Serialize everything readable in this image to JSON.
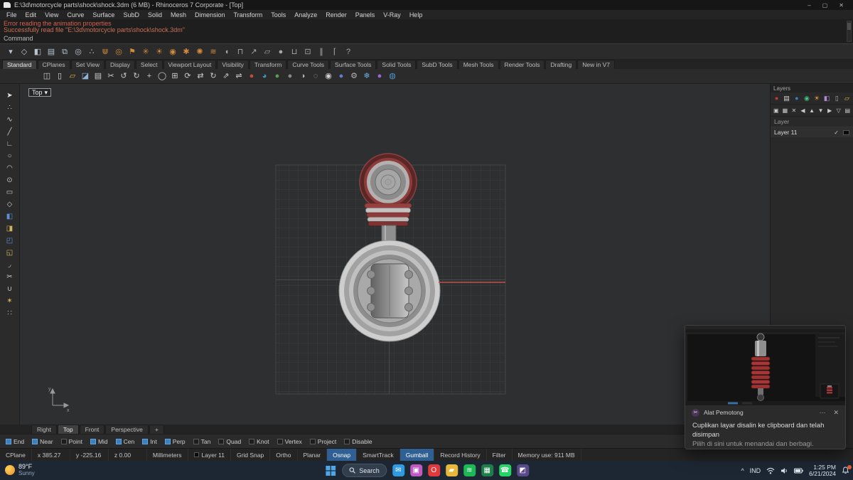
{
  "colors": {
    "accent_orange": "#d08b3c",
    "osnap_blue": "#3a7fbf",
    "error_red": "#d65f4f",
    "red_axis_line": "#c4504e",
    "viewport_bg": "#2e2f31"
  },
  "title_bar": {
    "title": "E:\\3d\\motorcycle parts\\shock\\shock.3dm (6 MB) - Rhinoceros 7 Corporate - [Top]",
    "minimize": "–",
    "maximize": "▢",
    "close": "✕"
  },
  "menu_bar": {
    "items": [
      {
        "label": "File"
      },
      {
        "label": "Edit"
      },
      {
        "label": "View"
      },
      {
        "label": "Curve"
      },
      {
        "label": "Surface"
      },
      {
        "label": "SubD"
      },
      {
        "label": "Solid"
      },
      {
        "label": "Mesh"
      },
      {
        "label": "Dimension"
      },
      {
        "label": "Transform"
      },
      {
        "label": "Tools"
      },
      {
        "label": "Analyze"
      },
      {
        "label": "Render"
      },
      {
        "label": "Panels"
      },
      {
        "label": "V-Ray"
      },
      {
        "label": "Help"
      }
    ]
  },
  "command_area": {
    "lines": [
      {
        "text": "Error reading the animation properties",
        "color": "#d65f4f"
      },
      {
        "text": "Successfully read file \"E:\\3d\\motorcycle parts\\shock\\shock.3dm\"",
        "color": "#c97055"
      }
    ],
    "prompt": "Command"
  },
  "toolbar_tabs": {
    "items": [
      {
        "label": "Standard",
        "state": "active"
      },
      {
        "label": "CPlanes"
      },
      {
        "label": "Set View"
      },
      {
        "label": "Display"
      },
      {
        "label": "Select"
      },
      {
        "label": "Viewport Layout"
      },
      {
        "label": "Visibility"
      },
      {
        "label": "Transform"
      },
      {
        "label": "Curve Tools"
      },
      {
        "label": "Surface Tools"
      },
      {
        "label": "Solid Tools"
      },
      {
        "label": "SubD Tools"
      },
      {
        "label": "Mesh Tools"
      },
      {
        "label": "Render Tools"
      },
      {
        "label": "Drafting"
      },
      {
        "label": "New in V7"
      }
    ]
  },
  "toolbar_main": {
    "icons": [
      {
        "name": "popup-menu-icon",
        "glyph": "▾",
        "color": "#b9c4cf"
      },
      {
        "name": "object-snap-icon",
        "glyph": "◇",
        "color": "#b9c4cf"
      },
      {
        "name": "display-mode-icon",
        "glyph": "◧",
        "color": "#b9c4cf"
      },
      {
        "name": "layer-state-icon",
        "glyph": "▤",
        "color": "#b9c4cf"
      },
      {
        "name": "group-objects-icon",
        "glyph": "⧉",
        "color": "#b9c4cf"
      },
      {
        "name": "visibility-icon",
        "glyph": "◎",
        "color": "#b9c4cf"
      },
      {
        "name": "select-points-icon",
        "glyph": "∴",
        "color": "#b9c4cf"
      },
      {
        "name": "mesh-cup-icon",
        "glyph": "⋓",
        "color": "#d08b3c"
      },
      {
        "name": "torus-icon",
        "glyph": "◎",
        "color": "#d08b3c"
      },
      {
        "name": "cone-flag-icon",
        "glyph": "⚑",
        "color": "#d08b3c"
      },
      {
        "name": "star-points-icon",
        "glyph": "✳",
        "color": "#d08b3c"
      },
      {
        "name": "sun-icon",
        "glyph": "☀",
        "color": "#d08b3c"
      },
      {
        "name": "donut-icon",
        "glyph": "◉",
        "color": "#d08b3c"
      },
      {
        "name": "gear-icon",
        "glyph": "✱",
        "color": "#d08b3c"
      },
      {
        "name": "spark-icon",
        "glyph": "✺",
        "color": "#d08b3c"
      },
      {
        "name": "hatch-lines-icon",
        "glyph": "≋",
        "color": "#d08b3c"
      },
      {
        "name": "lamp-icon",
        "glyph": "◖",
        "color": "#a8a8a8"
      },
      {
        "name": "magnet-icon",
        "glyph": "⊓",
        "color": "#a8a8a8"
      },
      {
        "name": "arrow-tool-icon",
        "glyph": "↗",
        "color": "#a8a8a8"
      },
      {
        "name": "plane-icon",
        "glyph": "▱",
        "color": "#a8a8a8"
      },
      {
        "name": "sphere-tool-icon",
        "glyph": "●",
        "color": "#a8a8a8"
      },
      {
        "name": "cylinder-tool-icon",
        "glyph": "⊔",
        "color": "#a8a8a8"
      },
      {
        "name": "box-tool-icon",
        "glyph": "⊡",
        "color": "#a8a8a8"
      },
      {
        "name": "pipe-tool-icon",
        "glyph": "∥",
        "color": "#a8a8a8"
      },
      {
        "name": "bracket-tool-icon",
        "glyph": "⌈",
        "color": "#a8a8a8"
      },
      {
        "name": "help-icon",
        "glyph": "?",
        "color": "#a8a8a8"
      }
    ]
  },
  "toolbar_second": {
    "icons": [
      {
        "name": "paste-icon",
        "glyph": "◫",
        "color": "#c9c9c9"
      },
      {
        "name": "new-file-icon",
        "glyph": "▯",
        "color": "#dcdcdc"
      },
      {
        "name": "open-folder-icon",
        "glyph": "▱",
        "color": "#d9b23f"
      },
      {
        "name": "save-icon",
        "glyph": "◪",
        "color": "#8fb3d9"
      },
      {
        "name": "print-icon",
        "glyph": "▤",
        "color": "#c9c9c9"
      },
      {
        "name": "cut-icon",
        "glyph": "✂",
        "color": "#c9c9c9"
      },
      {
        "name": "undo-icon",
        "glyph": "↺",
        "color": "#c9c9c9"
      },
      {
        "name": "redo-icon",
        "glyph": "↻",
        "color": "#c9c9c9"
      },
      {
        "name": "pan-icon",
        "glyph": "+",
        "color": "#c9c9c9"
      },
      {
        "name": "zoom-icon",
        "glyph": "◯",
        "color": "#c9c9c9"
      },
      {
        "name": "zoom-extents-icon",
        "glyph": "⊞",
        "color": "#c9c9c9"
      },
      {
        "name": "rotate-view-icon",
        "glyph": "⟳",
        "color": "#c9c9c9"
      },
      {
        "name": "move-icon",
        "glyph": "⇄",
        "color": "#c9c9c9"
      },
      {
        "name": "rotate-icon",
        "glyph": "↻",
        "color": "#c9c9c9"
      },
      {
        "name": "scale-icon",
        "glyph": "⇗",
        "color": "#c9c9c9"
      },
      {
        "name": "mirror-icon",
        "glyph": "⇌",
        "color": "#c9c9c9"
      },
      {
        "name": "red-sphere-icon",
        "glyph": "●",
        "color": "#c14a3a"
      },
      {
        "name": "rgb-sphere-icon",
        "glyph": "◕",
        "color": "#3a9ac0"
      },
      {
        "name": "green-sphere-icon",
        "glyph": "●",
        "color": "#55a055"
      },
      {
        "name": "gray-sphere-icon",
        "glyph": "●",
        "color": "#8a8a8a"
      },
      {
        "name": "shaded-sphere-icon",
        "glyph": "◑",
        "color": "#b5b5b5"
      },
      {
        "name": "wire-sphere-icon",
        "glyph": "◌",
        "color": "#b5b5b5"
      },
      {
        "name": "render-icon",
        "glyph": "◉",
        "color": "#d0d0d0"
      },
      {
        "name": "material-sphere-icon",
        "glyph": "●",
        "color": "#5a7fd4"
      },
      {
        "name": "options-gear-icon",
        "glyph": "⚙",
        "color": "#b5b5b5"
      },
      {
        "name": "snowflake-icon",
        "glyph": "❄",
        "color": "#6ab0e8"
      },
      {
        "name": "purple-sphere-icon",
        "glyph": "●",
        "color": "#9a6ad4"
      },
      {
        "name": "earth-icon",
        "glyph": "◍",
        "color": "#4a9ad4"
      }
    ]
  },
  "sidebar": {
    "icons": [
      {
        "name": "select-arrow-icon",
        "glyph": "➤",
        "color": "#e2e2e2"
      },
      {
        "name": "points-icon",
        "glyph": "∴",
        "color": "#c9c9c9"
      },
      {
        "name": "curve-icon",
        "glyph": "∿",
        "color": "#c9c9c9"
      },
      {
        "name": "line-icon",
        "glyph": "╱",
        "color": "#c9c9c9"
      },
      {
        "name": "polyline-icon",
        "glyph": "∟",
        "color": "#c9c9c9"
      },
      {
        "name": "circle-icon",
        "glyph": "○",
        "color": "#c9c9c9"
      },
      {
        "name": "arc-icon",
        "glyph": "◠",
        "color": "#c9c9c9"
      },
      {
        "name": "ellipse-icon",
        "glyph": "⊙",
        "color": "#c9c9c9"
      },
      {
        "name": "rectangle-icon",
        "glyph": "▭",
        "color": "#c9c9c9"
      },
      {
        "name": "polygon-icon",
        "glyph": "◇",
        "color": "#c9c9c9"
      },
      {
        "name": "surface-icon",
        "glyph": "◧",
        "color": "#5b8fd4"
      },
      {
        "name": "sweep-icon",
        "glyph": "◨",
        "color": "#d4b25b"
      },
      {
        "name": "extrude-icon",
        "glyph": "◰",
        "color": "#5b8fd4"
      },
      {
        "name": "loft-icon",
        "glyph": "◱",
        "color": "#d4b25b"
      },
      {
        "name": "fillet-icon",
        "glyph": "◞",
        "color": "#c9c9c9"
      },
      {
        "name": "trim-icon",
        "glyph": "✂",
        "color": "#c9c9c9"
      },
      {
        "name": "join-icon",
        "glyph": "∪",
        "color": "#c9c9c9"
      },
      {
        "name": "explode-icon",
        "glyph": "✶",
        "color": "#d4b25b"
      },
      {
        "name": "array-icon",
        "glyph": "∷",
        "color": "#c9c9c9"
      }
    ]
  },
  "viewport": {
    "label": "Top",
    "dropdown": "▾"
  },
  "layers_panel": {
    "title": "Layers",
    "tab_icons": [
      {
        "name": "properties-tab-icon",
        "glyph": "●",
        "color": "#c23b3b"
      },
      {
        "name": "layers-tab-icon",
        "glyph": "▤",
        "color": "#d8d8d8"
      },
      {
        "name": "rendering-tab-icon",
        "glyph": "●",
        "color": "#3b7fc2"
      },
      {
        "name": "materials-tab-icon",
        "glyph": "◉",
        "color": "#3bc27f"
      },
      {
        "name": "lights-tab-icon",
        "glyph": "☀",
        "color": "#d9a43a"
      },
      {
        "name": "display-tab-icon",
        "glyph": "◧",
        "color": "#b08ad4"
      },
      {
        "name": "notes-tab-icon",
        "glyph": "▯",
        "color": "#b0b0b0"
      },
      {
        "name": "open-panel-icon",
        "glyph": "▱",
        "color": "#d9b23f"
      }
    ],
    "toolbar_icons": [
      {
        "name": "new-layer-icon",
        "glyph": "▣",
        "color": "#c9c9c9"
      },
      {
        "name": "new-sublayer-icon",
        "glyph": "▦",
        "color": "#c9c9c9"
      },
      {
        "name": "delete-layer-icon",
        "glyph": "✕",
        "color": "#c9c9c9"
      },
      {
        "name": "move-left-icon",
        "glyph": "◀",
        "color": "#c9c9c9"
      },
      {
        "name": "move-up-icon",
        "glyph": "▲",
        "color": "#c9c9c9"
      },
      {
        "name": "move-down-icon",
        "glyph": "▼",
        "color": "#c9c9c9"
      },
      {
        "name": "move-right-icon",
        "glyph": "▶",
        "color": "#c9c9c9"
      },
      {
        "name": "filter-layers-icon",
        "glyph": "▽",
        "color": "#c9c9c9"
      },
      {
        "name": "layer-tools-icon",
        "glyph": "▤",
        "color": "#c9c9c9"
      }
    ],
    "column_header": "Layer",
    "rows": [
      {
        "name": "Layer 11",
        "check": "✓",
        "swatch": "#0a0a0a"
      }
    ]
  },
  "viewport_tabs": {
    "items": [
      {
        "label": "Right"
      },
      {
        "label": "Top",
        "state": "active"
      },
      {
        "label": "Front"
      },
      {
        "label": "Perspective"
      },
      {
        "label": "+"
      }
    ]
  },
  "osnap": {
    "items": [
      {
        "label": "End",
        "state": "checked"
      },
      {
        "label": "Near",
        "state": "checked"
      },
      {
        "label": "Point",
        "state": ""
      },
      {
        "label": "Mid",
        "state": "checked"
      },
      {
        "label": "Cen",
        "state": "checked"
      },
      {
        "label": "Int",
        "state": "checked"
      },
      {
        "label": "Perp",
        "state": "checked"
      },
      {
        "label": "Tan",
        "state": ""
      },
      {
        "label": "Quad",
        "state": ""
      },
      {
        "label": "Knot",
        "state": ""
      },
      {
        "label": "Vertex",
        "state": ""
      },
      {
        "label": "Project",
        "state": ""
      },
      {
        "label": "Disable",
        "state": ""
      }
    ]
  },
  "status_bar": {
    "items": [
      {
        "label": "CPlane",
        "kind": "btn"
      },
      {
        "label": "x 385.27",
        "kind": "coord"
      },
      {
        "label": "y -225.16",
        "kind": "coord"
      },
      {
        "label": "z 0.00",
        "kind": "coord"
      },
      {
        "label": "Millimeters",
        "kind": "btn"
      },
      {
        "label": "Layer 11",
        "kind": "layer",
        "swatch": "#0a0a0a"
      },
      {
        "label": "Grid Snap",
        "kind": "toggle"
      },
      {
        "label": "Ortho",
        "kind": "toggle"
      },
      {
        "label": "Planar",
        "kind": "toggle"
      },
      {
        "label": "Osnap",
        "kind": "toggle active"
      },
      {
        "label": "SmartTrack",
        "kind": "toggle"
      },
      {
        "label": "Gumball",
        "kind": "toggle active"
      },
      {
        "label": "Record History",
        "kind": "toggle"
      },
      {
        "label": "Filter",
        "kind": "toggle"
      },
      {
        "label": "Memory use: 911 MB",
        "kind": "info"
      }
    ]
  },
  "notification": {
    "app_name": "Alat Pemotong",
    "menu": "⋯",
    "close": "✕",
    "message": "Cuplikan layar disalin ke clipboard dan telah disimpan",
    "action_hint": "Pilih di sini untuk menandai dan berbagi."
  },
  "taskbar": {
    "weather": {
      "temp": "89°F",
      "condition": "Sunny"
    },
    "search_label": "Search",
    "apps": [
      {
        "name": "mail-app-icon",
        "glyph": "✉",
        "color": "#2f9ae0"
      },
      {
        "name": "photos-app-icon",
        "glyph": "▣",
        "color": "#c05ac0"
      },
      {
        "name": "opera-app-icon",
        "glyph": "O",
        "color": "#e23a3a"
      },
      {
        "name": "explorer-app-icon",
        "glyph": "▰",
        "color": "#e8b83a"
      },
      {
        "name": "spotify-app-icon",
        "glyph": "≋",
        "color": "#1db954"
      },
      {
        "name": "excel-app-icon",
        "glyph": "▦",
        "color": "#1e7e4a"
      },
      {
        "name": "whatsapp-app-icon",
        "glyph": "☎",
        "color": "#25d366"
      },
      {
        "name": "studio-app-icon",
        "glyph": "◩",
        "color": "#5a4a8a"
      }
    ],
    "tray": {
      "chevron": "^",
      "language": "IND",
      "time": "1:25 PM",
      "date": "6/21/2024"
    }
  }
}
